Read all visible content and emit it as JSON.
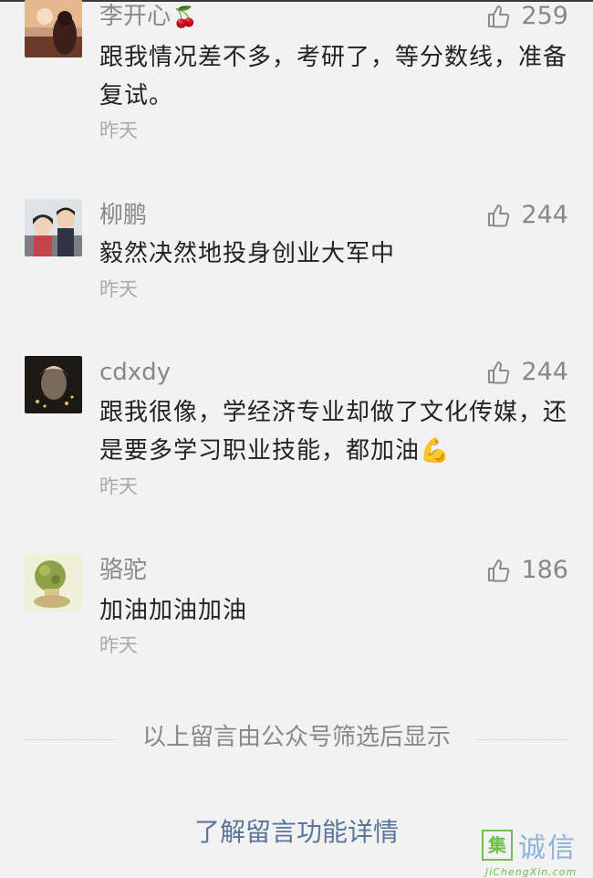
{
  "comments": [
    {
      "name": "李开心",
      "name_emoji": "🍒",
      "likes": "259",
      "text": "跟我情况差不多，考研了，等分数线，准备复试。",
      "time": "昨天"
    },
    {
      "name": "柳鹏",
      "name_emoji": "",
      "likes": "244",
      "text": "毅然决然地投身创业大军中",
      "time": "昨天"
    },
    {
      "name": "cdxdy",
      "name_emoji": "",
      "likes": "244",
      "text": "跟我很像，学经济专业却做了文化传媒，还是要多学习职业技能，都加油💪",
      "time": "昨天"
    },
    {
      "name": "骆驼",
      "name_emoji": "",
      "likes": "186",
      "text": "加油加油加油",
      "time": "昨天"
    }
  ],
  "footer": {
    "note": "以上留言由公众号筛选后显示",
    "link": "了解留言功能详情"
  },
  "watermark": {
    "box_char": "集",
    "chars": "诚信",
    "url": "JiChengXin.com"
  },
  "colors": {
    "background": "#f2f2f2",
    "name": "#888888",
    "text": "#222222",
    "time": "#aaaaaa",
    "link": "#5b7499"
  }
}
